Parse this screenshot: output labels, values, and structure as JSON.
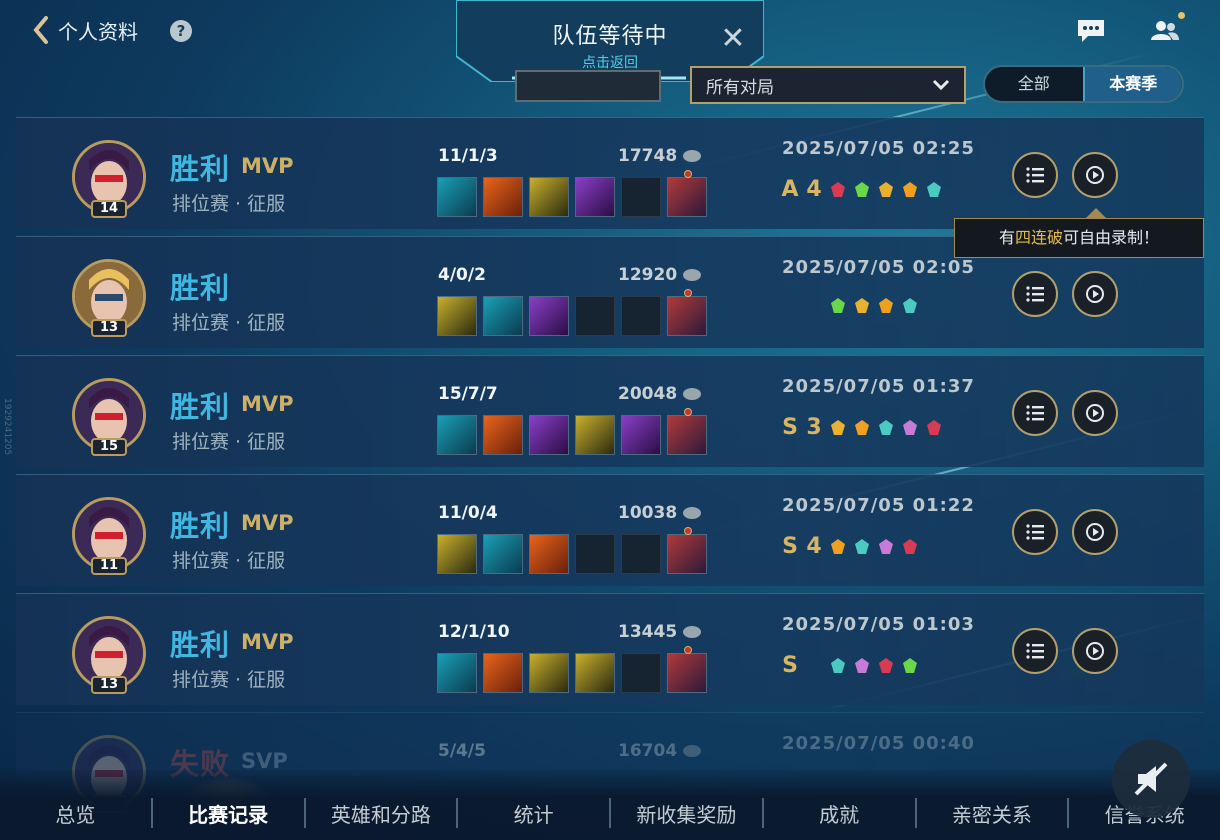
{
  "header": {
    "back_label": "个人资料",
    "queue_title": "队伍等待中",
    "queue_sub": "点击返回",
    "filter_select": "所有对局",
    "toggle_all": "全部",
    "toggle_season": "本赛季"
  },
  "side_text": "1929241205",
  "tooltip": {
    "pre": "有",
    "highlight": "四连破",
    "post": "可自由录制！"
  },
  "matches": [
    {
      "result": "胜利",
      "mvp": "MVP",
      "mode": "排位赛 · 征服",
      "level": "14",
      "kda": "11/1/3",
      "gold": "17748",
      "time": "2025/07/05 02:25",
      "grade": "A",
      "kills": "4"
    },
    {
      "result": "胜利",
      "mvp": "",
      "mode": "排位赛 · 征服",
      "level": "13",
      "kda": "4/0/2",
      "gold": "12920",
      "time": "2025/07/05 02:05",
      "grade": "",
      "kills": ""
    },
    {
      "result": "胜利",
      "mvp": "MVP",
      "mode": "排位赛 · 征服",
      "level": "15",
      "kda": "15/7/7",
      "gold": "20048",
      "time": "2025/07/05 01:37",
      "grade": "S",
      "kills": "3"
    },
    {
      "result": "胜利",
      "mvp": "MVP",
      "mode": "排位赛 · 征服",
      "level": "11",
      "kda": "11/0/4",
      "gold": "10038",
      "time": "2025/07/05 01:22",
      "grade": "S",
      "kills": "4"
    },
    {
      "result": "胜利",
      "mvp": "MVP",
      "mode": "排位赛 · 征服",
      "level": "13",
      "kda": "12/1/10",
      "gold": "13445",
      "time": "2025/07/05 01:03",
      "grade": "S",
      "kills": ""
    },
    {
      "result": "失败",
      "mvp": "SVP",
      "mode": "",
      "level": "",
      "kda": "5/4/5",
      "gold": "16704",
      "time": "2025/07/05 00:40",
      "grade": "",
      "kills": ""
    }
  ],
  "nav": [
    {
      "label": "总览"
    },
    {
      "label": "比赛记录"
    },
    {
      "label": "英雄和分路"
    },
    {
      "label": "统计"
    },
    {
      "label": "新收集奖励"
    },
    {
      "label": "成就"
    },
    {
      "label": "亲密关系"
    },
    {
      "label": "信誉系统"
    }
  ]
}
